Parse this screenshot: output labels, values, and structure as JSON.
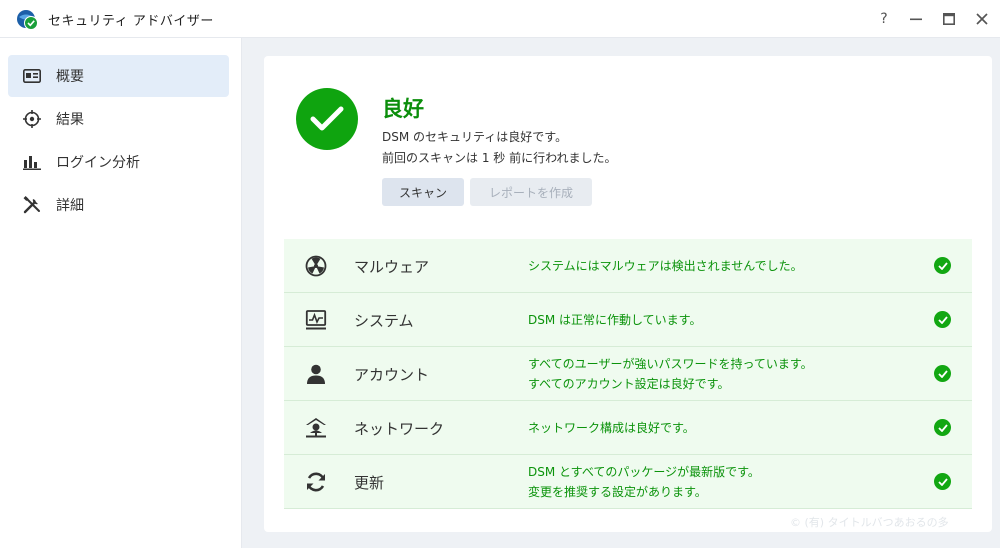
{
  "window": {
    "title": "セキュリティ アドバイザー",
    "help_label": "?"
  },
  "sidebar": {
    "items": [
      {
        "label": "概要",
        "icon": "overview-card-icon",
        "active": true
      },
      {
        "label": "結果",
        "icon": "crosshair-icon",
        "active": false
      },
      {
        "label": "ログイン分析",
        "icon": "bar-chart-icon",
        "active": false
      },
      {
        "label": "詳細",
        "icon": "tools-icon",
        "active": false
      }
    ]
  },
  "status": {
    "title": "良好",
    "line1": "DSM のセキュリティは良好です。",
    "line2": "前回のスキャンは 1 秒 前に行われました。",
    "scan_button": "スキャン",
    "report_button": "レポートを作成"
  },
  "checks": [
    {
      "name": "マルウェア",
      "icon": "biohazard-icon",
      "messages": [
        "システムにはマルウェアは検出されませんでした。"
      ]
    },
    {
      "name": "システム",
      "icon": "system-monitor-icon",
      "messages": [
        "DSM は正常に作動しています。"
      ]
    },
    {
      "name": "アカウント",
      "icon": "user-icon",
      "messages": [
        "すべてのユーザーが強いパスワードを持っています。",
        "すべてのアカウント設定は良好です。"
      ]
    },
    {
      "name": "ネットワーク",
      "icon": "network-icon",
      "messages": [
        "ネットワーク構成は良好です。"
      ]
    },
    {
      "name": "更新",
      "icon": "refresh-icon",
      "messages": [
        "DSM とすべてのパッケージが最新版です。",
        "変更を推奨する設定があります。"
      ]
    }
  ],
  "colors": {
    "ok_green": "#0fa40f",
    "ok_text": "#0b930b",
    "row_bg": "#effbef",
    "active_nav": "#e3edf9",
    "main_bg": "#eef1f5"
  },
  "watermark": "© (有) タイトルバつあおるの多"
}
